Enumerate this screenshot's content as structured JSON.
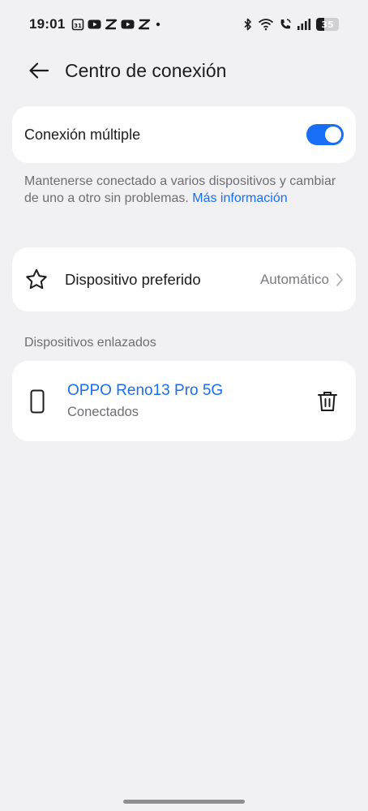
{
  "status_bar": {
    "time": "19:01",
    "battery_level": "35",
    "icons": [
      "calendar-icon",
      "youtube-icon",
      "capcut-icon",
      "youtube-icon",
      "capcut-icon",
      "dot-icon",
      "bluetooth-icon",
      "wifi-icon",
      "call-icon",
      "signal-icon",
      "battery-icon"
    ]
  },
  "header": {
    "title": "Centro de conexión"
  },
  "multi_connection": {
    "label": "Conexión múltiple",
    "enabled": true
  },
  "description": {
    "text": "Mantenerse conectado a varios dispositivos y cambiar de uno a otro sin problemas.",
    "link": "Más información"
  },
  "preferred_device": {
    "label": "Dispositivo preferido",
    "value": "Automático"
  },
  "linked_devices": {
    "section_title": "Dispositivos enlazados",
    "items": [
      {
        "name": "OPPO Reno13 Pro 5G",
        "status": "Conectados"
      }
    ]
  },
  "colors": {
    "accent": "#1a6ef5",
    "background": "#f1f1f3",
    "card": "#ffffff",
    "secondary_text": "#6e6e73"
  }
}
